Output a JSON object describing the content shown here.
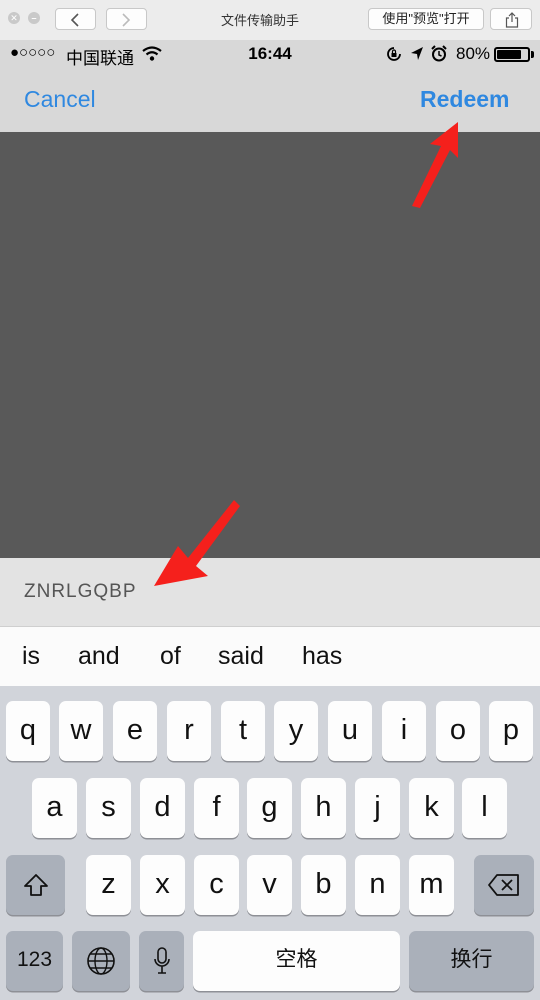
{
  "window": {
    "title": "文件传输助手",
    "open_with_preview": "使用\"预览\"打开"
  },
  "status_bar": {
    "signal": "●○○○○",
    "carrier": "中国联通",
    "time": "16:44",
    "battery_percent": "80%",
    "battery_level": 0.8
  },
  "nav": {
    "cancel": "Cancel",
    "redeem": "Redeem"
  },
  "code_field": {
    "value": "ZNRLGQBP"
  },
  "suggestions": [
    "is",
    "and",
    "of",
    "said",
    "has"
  ],
  "keyboard": {
    "row1": [
      "q",
      "w",
      "e",
      "r",
      "t",
      "y",
      "u",
      "i",
      "o",
      "p"
    ],
    "row2": [
      "a",
      "s",
      "d",
      "f",
      "g",
      "h",
      "j",
      "k",
      "l"
    ],
    "row3": [
      "z",
      "x",
      "c",
      "v",
      "b",
      "n",
      "m"
    ],
    "numbers_key": "123",
    "space": "空格",
    "return": "换行"
  },
  "colors": {
    "accent": "#2f88e0",
    "arrow": "#f5201c",
    "camera_bg": "#595959"
  },
  "icons": [
    "close-icon",
    "minimize-icon",
    "chevron-left-icon",
    "chevron-right-icon",
    "share-icon",
    "wifi-icon",
    "rotation-lock-icon",
    "location-icon",
    "alarm-icon",
    "battery-icon",
    "shift-icon",
    "delete-icon",
    "globe-icon",
    "microphone-icon",
    "arrow-icon"
  ]
}
